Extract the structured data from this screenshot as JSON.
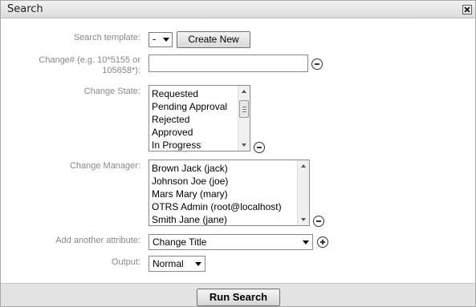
{
  "dialog": {
    "title": "Search",
    "close_icon": "close-x-icon"
  },
  "form": {
    "search_template": {
      "label": "Search template:",
      "value": "-",
      "create_button": "Create New"
    },
    "change_number": {
      "label_line1": "Change# (e.g. 10*5155 or",
      "label_line2": "105658*):",
      "value": ""
    },
    "change_state": {
      "label": "Change State:",
      "options": [
        "Requested",
        "Pending Approval",
        "Rejected",
        "Approved",
        "In Progress"
      ]
    },
    "change_manager": {
      "label": "Change Manager:",
      "options": [
        "Brown Jack (jack)",
        "Johnson Joe (joe)",
        "Mars Mary (mary)",
        "OTRS Admin (root@localhost)",
        "Smith Jane (jane)"
      ]
    },
    "add_attribute": {
      "label": "Add another attribute:",
      "value": "Change Title"
    },
    "output": {
      "label": "Output:",
      "value": "Normal"
    }
  },
  "footer": {
    "run_button": "Run Search"
  }
}
